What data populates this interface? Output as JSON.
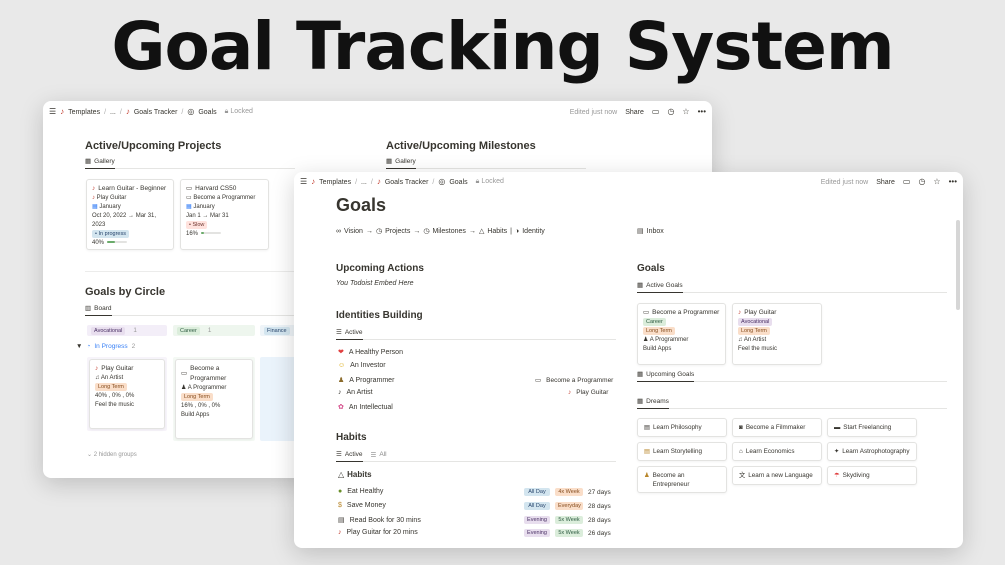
{
  "hero": {
    "title": "Goal Tracking System"
  },
  "back": {
    "topbar": {
      "crumbs": [
        "Templates",
        "...",
        "Goals Tracker",
        "Goals"
      ],
      "locked": "Locked",
      "edited": "Edited just now",
      "share": "Share"
    },
    "projects": {
      "title": "Active/Upcoming Projects",
      "tab": "Gallery",
      "cards": [
        {
          "title": "Learn Guitar - Beginner",
          "habit": "Play Guitar",
          "month": "January",
          "dates": "Oct 20, 2022 → Mar 31, 2023",
          "status": "In progress",
          "progress_text": "40%",
          "progress": 0.4
        },
        {
          "title": "Harvard CS50",
          "habit": "Become a Programmer",
          "month": "January",
          "dates": "Jan 1 → Mar 31",
          "status": "Slow",
          "progress_text": "16%",
          "progress": 0.16
        }
      ]
    },
    "milestones": {
      "title": "Active/Upcoming Milestones",
      "tab": "Gallery"
    },
    "circle": {
      "title": "Goals by Circle",
      "tab": "Board",
      "columns": [
        {
          "name": "Avocational",
          "count": "1"
        },
        {
          "name": "Career",
          "count": "1"
        },
        {
          "name": "Finance",
          "count": ""
        }
      ],
      "group": {
        "name": "In Progress",
        "count": "2"
      },
      "cards": [
        {
          "title": "Play Guitar",
          "identity": "An Artist",
          "term": "Long Term",
          "pct": "40% , 0% , 0%",
          "note": "Feel the music"
        },
        {
          "title": "Become a Programmer",
          "identity": "A Programmer",
          "term": "Long Term",
          "pct": "16% , 0% , 0%",
          "note": "Build Apps"
        }
      ],
      "hidden": "2 hidden groups"
    }
  },
  "front": {
    "topbar": {
      "crumbs": [
        "Templates",
        "...",
        "Goals Tracker",
        "Goals"
      ],
      "locked": "Locked",
      "edited": "Edited just now",
      "share": "Share"
    },
    "title": "Goals",
    "nav": {
      "vision": "Vision",
      "projects": "Projects",
      "milestones": "Milestones",
      "habits": "Habits",
      "identity": "Identity",
      "arrow": "→",
      "pipe": "|",
      "inbox": "Inbox"
    },
    "actions": {
      "title": "Upcoming Actions",
      "text": "You Todoist Embed Here"
    },
    "identities": {
      "title": "Identities Building",
      "tab": "Active",
      "items": [
        {
          "icon": "❤",
          "label": "A Healthy Person",
          "link": ""
        },
        {
          "icon": "☺",
          "label": "An Investor",
          "link": ""
        },
        {
          "icon": "♟",
          "label": "A Programmer",
          "link": "Become a Programmer"
        },
        {
          "icon": "♪",
          "label": "An Artist",
          "link": "Play Guitar"
        },
        {
          "icon": "✿",
          "label": "An Intellectual",
          "link": ""
        }
      ]
    },
    "habits": {
      "title": "Habits",
      "tab_active": "Active",
      "tab_all": "All",
      "sub": "Habits",
      "items": [
        {
          "label": "Eat Healthy",
          "time": "All Day",
          "freq": "4x Week",
          "days": "27 days"
        },
        {
          "label": "Save Money",
          "time": "All Day",
          "freq": "Everyday",
          "days": "28 days"
        },
        {
          "label": "Read Book for 30 mins",
          "time": "Evening",
          "freq": "5x Week",
          "days": "28 days"
        },
        {
          "label": "Play Guitar for 20 mins",
          "time": "Evening",
          "freq": "5x Week",
          "days": "26 days"
        }
      ]
    },
    "goals": {
      "title": "Goals",
      "tab": "Active Goals",
      "cards": [
        {
          "title": "Become a Programmer",
          "circle": "Career",
          "term": "Long Term",
          "identity": "A Programmer",
          "note": "Build Apps"
        },
        {
          "title": "Play Guitar",
          "circle": "Avocational",
          "term": "Long Term",
          "identity": "An Artist",
          "note": "Feel the music"
        }
      ],
      "upcoming_tab": "Upcoming Goals",
      "dreams_tab": "Dreams",
      "dreams": [
        "Learn Philosophy",
        "Become a Filmmaker",
        "Start Freelancing",
        "Learn Storytelling",
        "Learn Economics",
        "Learn Astrophotography",
        "Become an Entrepreneur",
        "Learn a new Language",
        "Skydiving"
      ]
    }
  }
}
